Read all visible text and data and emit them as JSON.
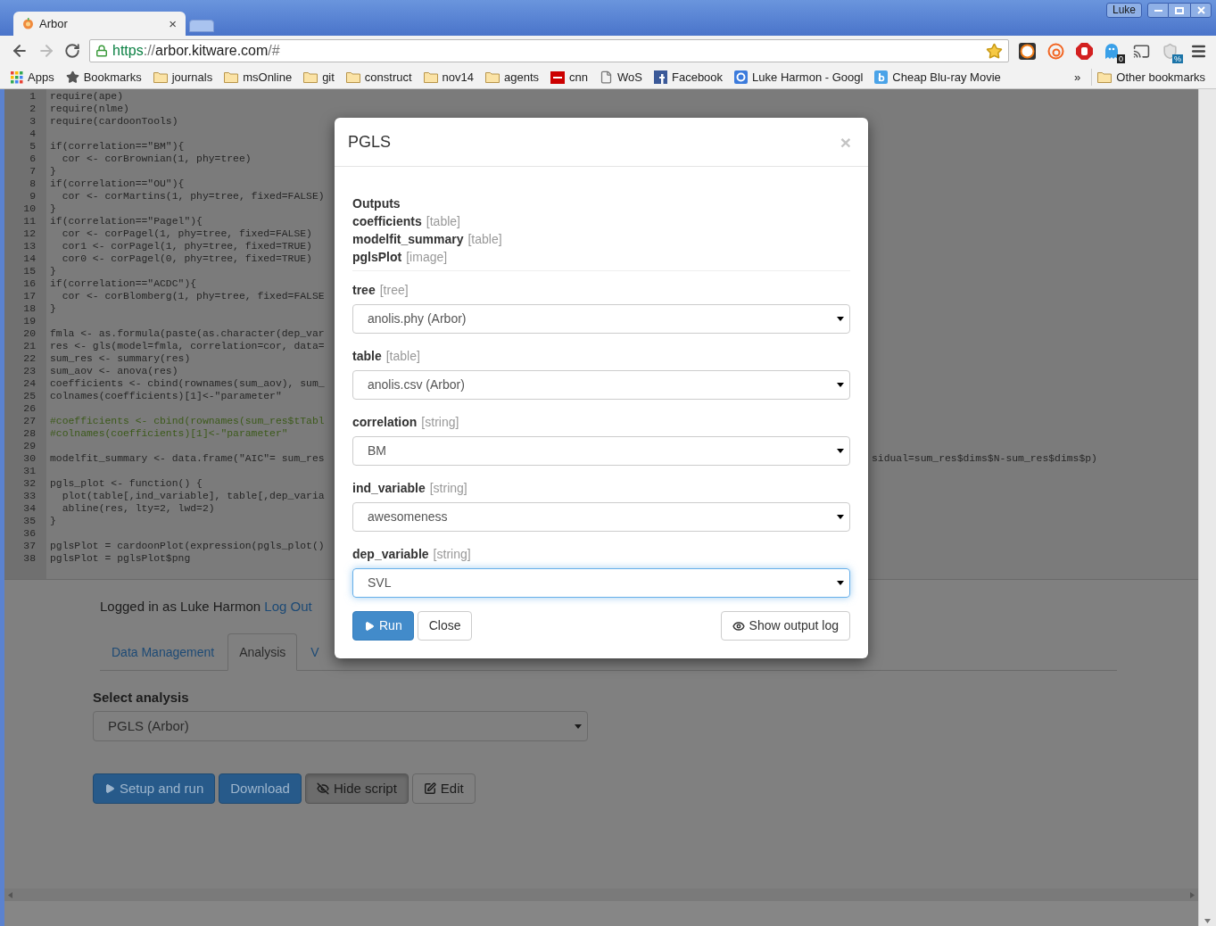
{
  "browser": {
    "tab": {
      "title": "Arbor",
      "close": "×"
    },
    "profile": "Luke",
    "url": [
      {
        "kind": "scheme",
        "text": "https"
      },
      {
        "kind": "punct",
        "text": "://"
      },
      {
        "kind": "host",
        "text": "arbor.kitware.com"
      },
      {
        "kind": "punct",
        "text": "/#"
      }
    ],
    "extension_badges": [
      "0",
      "%"
    ],
    "bookmarks": [
      {
        "kind": "apps",
        "label": "Apps"
      },
      {
        "kind": "star",
        "label": "Bookmarks"
      },
      {
        "kind": "folder",
        "label": "journals"
      },
      {
        "kind": "folder",
        "label": "msOnline"
      },
      {
        "kind": "folder",
        "label": "git"
      },
      {
        "kind": "folder",
        "label": "construct"
      },
      {
        "kind": "folder",
        "label": "nov14"
      },
      {
        "kind": "folder",
        "label": "agents"
      },
      {
        "kind": "red-logo",
        "label": "cnn"
      },
      {
        "kind": "page",
        "label": "WoS"
      },
      {
        "kind": "f-logo",
        "label": "Facebook"
      },
      {
        "kind": "g-logo",
        "label": "Luke Harmon - Googl"
      },
      {
        "kind": "b-logo",
        "label": "Cheap Blu-ray Movie"
      }
    ],
    "overflow": "»",
    "other_bookmarks": "Other bookmarks"
  },
  "editor": {
    "lines": [
      {
        "number": "1",
        "kind": "code",
        "text": "require(ape)"
      },
      {
        "number": "2",
        "kind": "code",
        "text": "require(nlme)"
      },
      {
        "number": "3",
        "kind": "code",
        "text": "require(cardoonTools)"
      },
      {
        "number": "4"
      },
      {
        "number": "5",
        "kind": "code",
        "text": "if(correlation==\"BM\"){"
      },
      {
        "number": "6",
        "kind": "code",
        "text": "  cor <- corBrownian(1, phy=tree)"
      },
      {
        "number": "7",
        "kind": "code",
        "text": "}"
      },
      {
        "number": "8",
        "kind": "code",
        "text": "if(correlation==\"OU\"){"
      },
      {
        "number": "9",
        "kind": "code",
        "text": "  cor <- corMartins(1, phy=tree, fixed=FALSE)"
      },
      {
        "number": "10",
        "kind": "code",
        "text": "}"
      },
      {
        "number": "11",
        "kind": "code",
        "text": "if(correlation==\"Pagel\"){"
      },
      {
        "number": "12",
        "kind": "code",
        "text": "  cor <- corPagel(1, phy=tree, fixed=FALSE)"
      },
      {
        "number": "13",
        "kind": "code",
        "text": "  cor1 <- corPagel(1, phy=tree, fixed=TRUE)"
      },
      {
        "number": "14",
        "kind": "code",
        "text": "  cor0 <- corPagel(0, phy=tree, fixed=TRUE)"
      },
      {
        "number": "15",
        "kind": "code",
        "text": "}"
      },
      {
        "number": "16",
        "kind": "code",
        "text": "if(correlation==\"ACDC\"){"
      },
      {
        "number": "17",
        "kind": "code",
        "text": "  cor <- corBlomberg(1, phy=tree, fixed=FALSE"
      },
      {
        "number": "18",
        "kind": "code",
        "text": "}"
      },
      {
        "number": "19"
      },
      {
        "number": "20",
        "kind": "code",
        "text": "fmla <- as.formula(paste(as.character(dep_var"
      },
      {
        "number": "21",
        "kind": "code",
        "text": "res <- gls(model=fmla, correlation=cor, data="
      },
      {
        "number": "22",
        "kind": "code",
        "text": "sum_res <- summary(res)"
      },
      {
        "number": "23",
        "kind": "code",
        "text": "sum_aov <- anova(res)"
      },
      {
        "number": "24",
        "kind": "code",
        "text": "coefficients <- cbind(rownames(sum_aov), sum_"
      },
      {
        "number": "25",
        "kind": "code",
        "text": "colnames(coefficients)[1]<-\"parameter\""
      },
      {
        "number": "26"
      },
      {
        "number": "27",
        "kind": "comment",
        "text": "#coefficients <- cbind(rownames(sum_res$tTabl"
      },
      {
        "number": "28",
        "kind": "comment",
        "text": "#colnames(coefficients)[1]<-\"parameter\""
      },
      {
        "number": "29"
      },
      {
        "number": "30",
        "kind": "code",
        "text": "modelfit_summary <- data.frame(\"AIC\"= sum_res",
        "tail": "sidual=sum_res$dims$N-sum_res$dims$p)"
      },
      {
        "number": "31"
      },
      {
        "number": "32",
        "kind": "code",
        "text": "pgls_plot <- function() {"
      },
      {
        "number": "33",
        "kind": "code",
        "text": "  plot(table[,ind_variable], table[,dep_varia"
      },
      {
        "number": "34",
        "kind": "code",
        "text": "  abline(res, lty=2, lwd=2)"
      },
      {
        "number": "35",
        "kind": "code",
        "text": "}"
      },
      {
        "number": "36"
      },
      {
        "number": "37",
        "kind": "code",
        "text": "pglsPlot = cardoonPlot(expression(pgls_plot()"
      },
      {
        "number": "38",
        "kind": "code",
        "text": "pglsPlot = pglsPlot$png"
      }
    ]
  },
  "page": {
    "login": {
      "text": "Logged in as Luke Harmon",
      "link": "Log Out"
    },
    "tabs": [
      {
        "label": "Data Management",
        "selected": false
      },
      {
        "label": "Analysis",
        "selected": true
      },
      {
        "label": "V",
        "selected": false
      }
    ],
    "select_label": "Select analysis",
    "analysis_select": "PGLS (Arbor)",
    "buttons": [
      {
        "kind": "play",
        "label": "Setup and run"
      },
      {
        "kind": "plain",
        "label": "Download"
      },
      {
        "kind": "eye",
        "label": "Hide script"
      },
      {
        "kind": "edit",
        "label": "Edit"
      }
    ]
  },
  "modal": {
    "title": "PGLS",
    "close": "×",
    "outputs_heading": "Outputs",
    "outputs": [
      {
        "name": "coefficients",
        "type": "[table]"
      },
      {
        "name": "modelfit_summary",
        "type": "[table]"
      },
      {
        "name": "pglsPlot",
        "type": "[image]"
      }
    ],
    "fields": [
      {
        "name": "tree",
        "type": "[tree]",
        "value": "anolis.phy (Arbor)",
        "focused": false
      },
      {
        "name": "table",
        "type": "[table]",
        "value": "anolis.csv (Arbor)",
        "focused": false
      },
      {
        "name": "correlation",
        "type": "[string]",
        "value": "BM",
        "focused": false
      },
      {
        "name": "ind_variable",
        "type": "[string]",
        "value": "awesomeness",
        "focused": false
      },
      {
        "name": "dep_variable",
        "type": "[string]",
        "value": "SVL",
        "focused": true
      }
    ],
    "run": "Run",
    "close_button": "Close",
    "log_button": "Show output log"
  }
}
